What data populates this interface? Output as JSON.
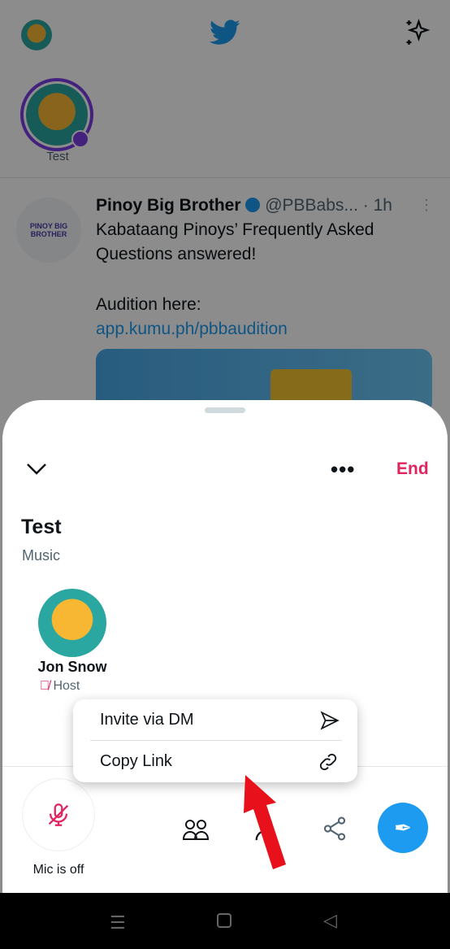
{
  "feed": {
    "fleet_label": "Test",
    "tweet": {
      "author": "Pinoy Big Brother",
      "handle": "@PBBabs...",
      "time": "· 1h",
      "line1": "Kabataang Pinoys’ Frequently Asked",
      "line2": "Questions answered!",
      "line3": "Audition here:",
      "link": "app.kumu.ph/pbbaudition",
      "avatar_text": "PINOY BIG BROTHER"
    }
  },
  "space": {
    "end_label": "End",
    "title": "Test",
    "topic": "Music",
    "host_name": "Jon Snow",
    "host_role": "Host",
    "mic_label": "Mic is off"
  },
  "menu": {
    "items": [
      {
        "label": "Invite via DM",
        "icon": "send-icon"
      },
      {
        "label": "Copy Link",
        "icon": "link-icon"
      }
    ]
  },
  "colors": {
    "accent": "#1d9bf0",
    "end": "#e0245e",
    "annotation": "#e8101a"
  }
}
